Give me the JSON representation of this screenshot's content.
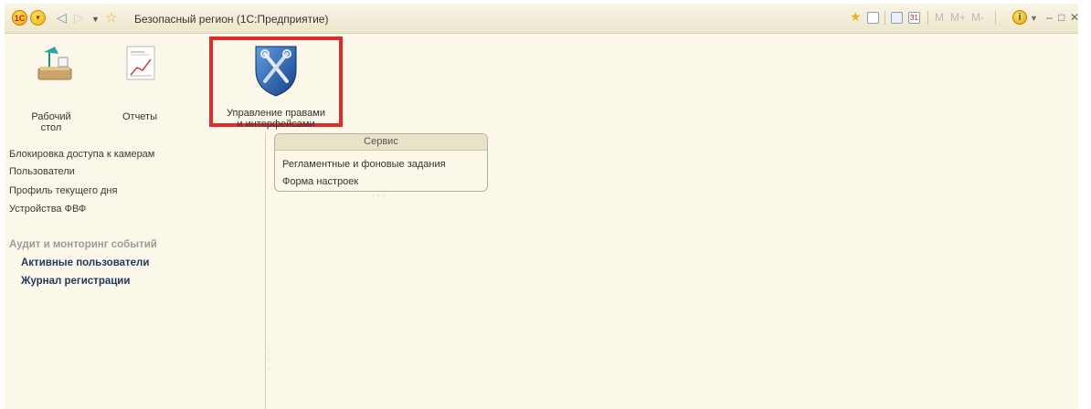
{
  "window": {
    "title": "Безопасный регион  (1С:Предприятие)",
    "logo_text": "1С",
    "right_labels": {
      "m": "M",
      "m_plus": "M+",
      "m_minus": "M-"
    },
    "window_buttons": {
      "minimize": "‒",
      "maximize": "□",
      "close": "✕"
    },
    "calendar_day": "31"
  },
  "sections": [
    {
      "label_line1": "Рабочий",
      "label_line2": "стол"
    },
    {
      "label_line1": "Отчеты",
      "label_line2": ""
    },
    {
      "label_line1": "Управление правами",
      "label_line2": "и интерфейсами"
    }
  ],
  "left_panel": {
    "links": [
      "Блокировка доступа к камерам",
      "Пользователи",
      "Профиль текущего дня",
      "Устройства ФВФ"
    ],
    "group_title": "Аудит и монторинг событий",
    "group_links": [
      "Активные пользователи",
      "Журнал регистрации"
    ]
  },
  "service": {
    "header": "Сервис",
    "links": [
      "Регламентные и фоновые задания",
      "Форма настроек"
    ]
  },
  "colors": {
    "highlight_border": "#e12a2a",
    "background": "#fbf8e9",
    "bold_link": "#223860"
  }
}
